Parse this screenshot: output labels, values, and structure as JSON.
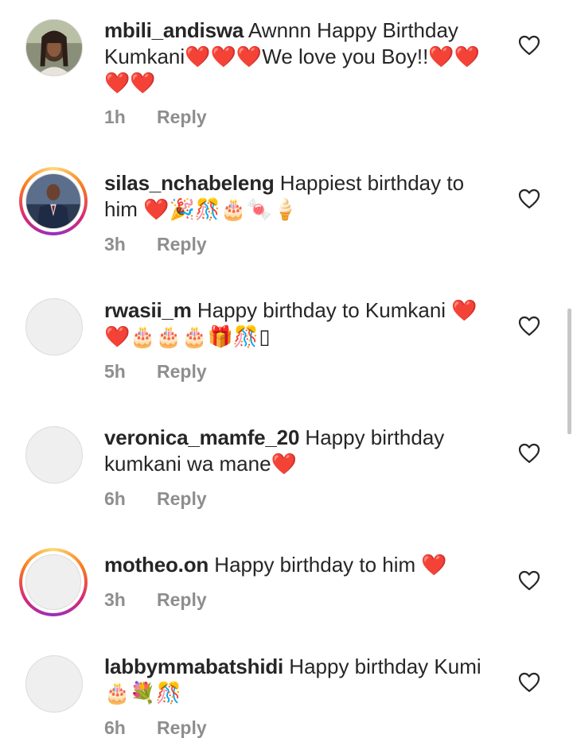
{
  "comments": [
    {
      "username": "mbili_andiswa",
      "text": " Awnnn Happy Birthday Kumkani❤️❤️❤️We love you Boy!!❤️❤️❤️❤️",
      "time": "1h",
      "reply_label": "Reply",
      "avatar": "photo",
      "story_ring": false
    },
    {
      "username": "silas_nchabeleng",
      "text": " Happiest birthday to him ❤️🎉🎊🎂🍬🍦",
      "time": "3h",
      "reply_label": "Reply",
      "avatar": "photo",
      "story_ring": true
    },
    {
      "username": "rwasii_m",
      "text": " Happy birthday to Kumkani ❤️❤️🎂🎂🎂🎁🎊▯",
      "time": "5h",
      "reply_label": "Reply",
      "avatar": "blank",
      "story_ring": false
    },
    {
      "username": "veronica_mamfe_20",
      "text": " Happy birthday kumkani wa mane❤️",
      "time": "6h",
      "reply_label": "Reply",
      "avatar": "blank",
      "story_ring": false
    },
    {
      "username": "motheo.on",
      "text": " Happy birthday to him ❤️",
      "time": "3h",
      "reply_label": "Reply",
      "avatar": "blank",
      "story_ring": true
    },
    {
      "username": "labbymmabatshidi",
      "text": " Happy birthday Kumi🎂💐🎊",
      "time": "6h",
      "reply_label": "Reply",
      "avatar": "blank",
      "story_ring": false
    }
  ],
  "icons": {
    "like": "heart-outline-icon"
  },
  "colors": {
    "text": "#262626",
    "meta": "#8e8e8e",
    "heart": "#ed4956"
  }
}
